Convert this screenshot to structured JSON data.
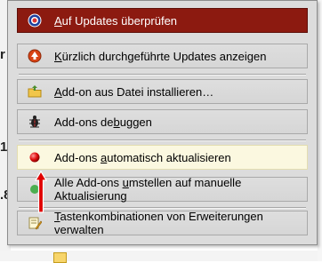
{
  "background": {
    "fragment_1": "r",
    "fragment_2": "1",
    "fragment_3": ".8"
  },
  "menu": {
    "items": [
      {
        "pre": "",
        "u": "A",
        "post": "uf Updates überprüfen",
        "icon": "update-check-icon"
      },
      {
        "pre": "",
        "u": "K",
        "post": "ürzlich durchgeführte Updates anzeigen",
        "icon": "recent-updates-icon"
      },
      {
        "pre": "",
        "u": "A",
        "post": "dd-on aus Datei installieren…",
        "icon": "install-from-file-icon"
      },
      {
        "pre": "Add-ons de",
        "u": "b",
        "post": "uggen",
        "icon": "debug-bug-icon"
      },
      {
        "pre": "Add-ons ",
        "u": "a",
        "post": "utomatisch aktualisieren",
        "icon": "red-dot-icon"
      },
      {
        "pre": "Alle Add-ons ",
        "u": "u",
        "post": "mstellen auf manuelle Aktualisierung",
        "icon": "green-dot-icon"
      },
      {
        "pre": "",
        "u": "T",
        "post": "astenkombinationen von Erweiterungen verwalten",
        "icon": "edit-shortcuts-icon"
      }
    ]
  },
  "colors": {
    "highlight": "#8c1a10",
    "active": "#fbf8e0",
    "arrow": "#e00000"
  }
}
